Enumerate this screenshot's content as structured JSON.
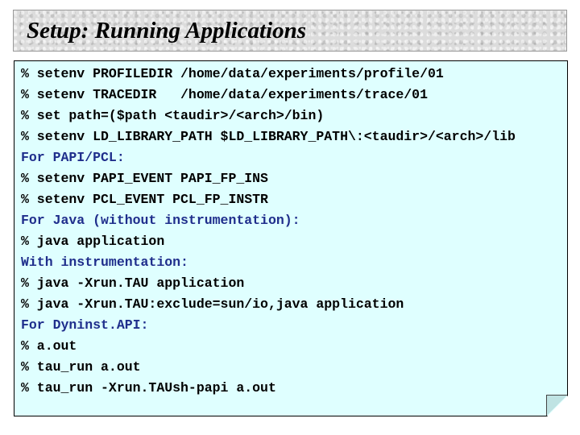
{
  "title": "Setup: Running Applications",
  "lines": [
    {
      "text": "% setenv PROFILEDIR /home/data/experiments/profile/01",
      "kind": "cmd"
    },
    {
      "text": "% setenv TRACEDIR   /home/data/experiments/trace/01",
      "kind": "cmd"
    },
    {
      "text": "% set path=($path <taudir>/<arch>/bin)",
      "kind": "cmd"
    },
    {
      "text": "% setenv LD_LIBRARY_PATH $LD_LIBRARY_PATH\\:<taudir>/<arch>/lib",
      "kind": "cmd"
    },
    {
      "text": "For PAPI/PCL:",
      "kind": "heading"
    },
    {
      "text": "% setenv PAPI_EVENT PAPI_FP_INS",
      "kind": "cmd"
    },
    {
      "text": "% setenv PCL_EVENT PCL_FP_INSTR",
      "kind": "cmd"
    },
    {
      "text": "For Java (without instrumentation):",
      "kind": "heading"
    },
    {
      "text": "% java application",
      "kind": "cmd"
    },
    {
      "text": "With instrumentation:",
      "kind": "heading"
    },
    {
      "text": "% java -Xrun.TAU application",
      "kind": "cmd"
    },
    {
      "text": "% java -Xrun.TAU:exclude=sun/io,java application",
      "kind": "cmd"
    },
    {
      "text": "For Dyninst.API:",
      "kind": "heading"
    },
    {
      "text": "% a.out",
      "kind": "cmd"
    },
    {
      "text": "% tau_run a.out",
      "kind": "cmd"
    },
    {
      "text": "% tau_run -Xrun.TAUsh-papi a.out",
      "kind": "cmd"
    }
  ],
  "colors": {
    "heading": "#1f2e8c",
    "command": "#000000",
    "box_background": "#dfffff"
  }
}
